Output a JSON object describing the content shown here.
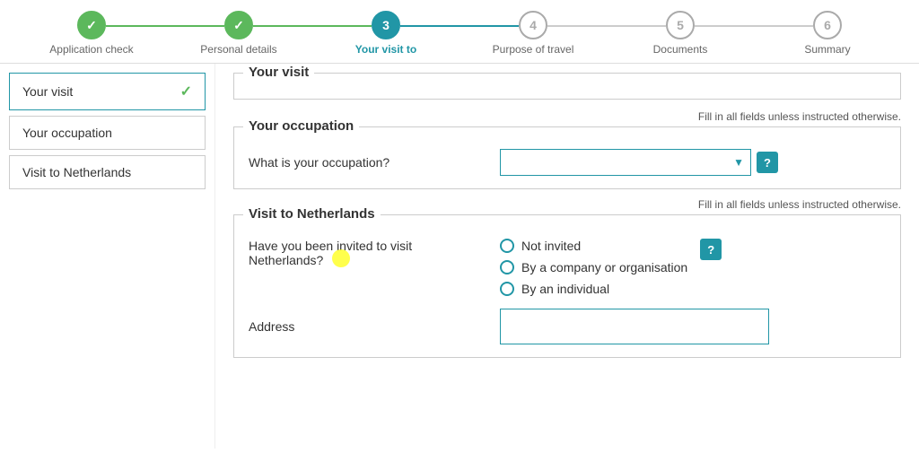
{
  "stepper": {
    "steps": [
      {
        "id": "application-check",
        "number": "✓",
        "label": "Application check",
        "state": "done"
      },
      {
        "id": "personal-details",
        "number": "✓",
        "label": "Personal details",
        "state": "done"
      },
      {
        "id": "your-visit-to",
        "number": "3",
        "label": "Your visit to",
        "state": "active"
      },
      {
        "id": "purpose-of-travel",
        "number": "4",
        "label": "Purpose of travel",
        "state": "inactive"
      },
      {
        "id": "documents",
        "number": "5",
        "label": "Documents",
        "state": "inactive"
      },
      {
        "id": "summary",
        "number": "6",
        "label": "Summary",
        "state": "inactive"
      }
    ]
  },
  "sidebar": {
    "items": [
      {
        "id": "your-visit",
        "label": "Your visit",
        "hasCheck": true
      },
      {
        "id": "your-occupation",
        "label": "Your occupation",
        "hasCheck": false
      },
      {
        "id": "visit-to-netherlands",
        "label": "Visit to Netherlands",
        "hasCheck": false
      }
    ]
  },
  "content": {
    "your_visit_section": {
      "title": "Your visit"
    },
    "your_occupation_section": {
      "title": "Your occupation",
      "fill_notice": "Fill in all fields unless instructed otherwise.",
      "occupation_question": "What is your occupation?",
      "help_label": "?"
    },
    "visit_netherlands_section": {
      "title": "Visit to Netherlands",
      "fill_notice": "Fill in all fields unless instructed otherwise.",
      "invitation_question_line1": "Have you been invited to visit",
      "invitation_question_line2": "Netherlands?",
      "radio_options": [
        {
          "id": "not-invited",
          "label": "Not invited"
        },
        {
          "id": "by-company",
          "label": "By a company or organisation"
        },
        {
          "id": "by-individual",
          "label": "By an individual"
        }
      ],
      "address_label": "Address",
      "help_label": "?"
    }
  }
}
